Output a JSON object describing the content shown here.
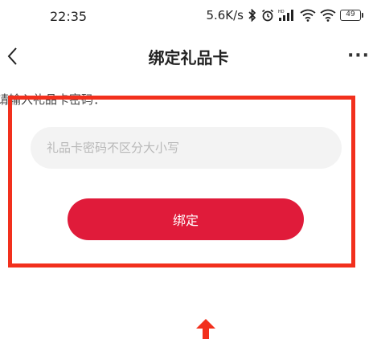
{
  "status_bar": {
    "time": "22:35",
    "net_speed": "5.6K/s",
    "hd_label": "HD",
    "battery": "49"
  },
  "nav": {
    "title": "绑定礼品卡",
    "more": "···"
  },
  "form": {
    "prompt": "请输入礼品卡密码：",
    "code_placeholder": "礼品卡密码不区分大小写",
    "code_value": "",
    "bind_label": "绑定"
  },
  "colors": {
    "accent": "#e01b3a",
    "highlight_frame": "#f2301d",
    "input_bg": "#f3f3f3",
    "placeholder": "#b8b8b8"
  },
  "icons": {
    "back": "chevron-left-icon",
    "bluetooth": "bluetooth-icon",
    "alarm": "alarm-clock-icon",
    "signal": "signal-icon",
    "wifi": "wifi-icon",
    "highlight_arrow": "up-arrow-icon"
  }
}
